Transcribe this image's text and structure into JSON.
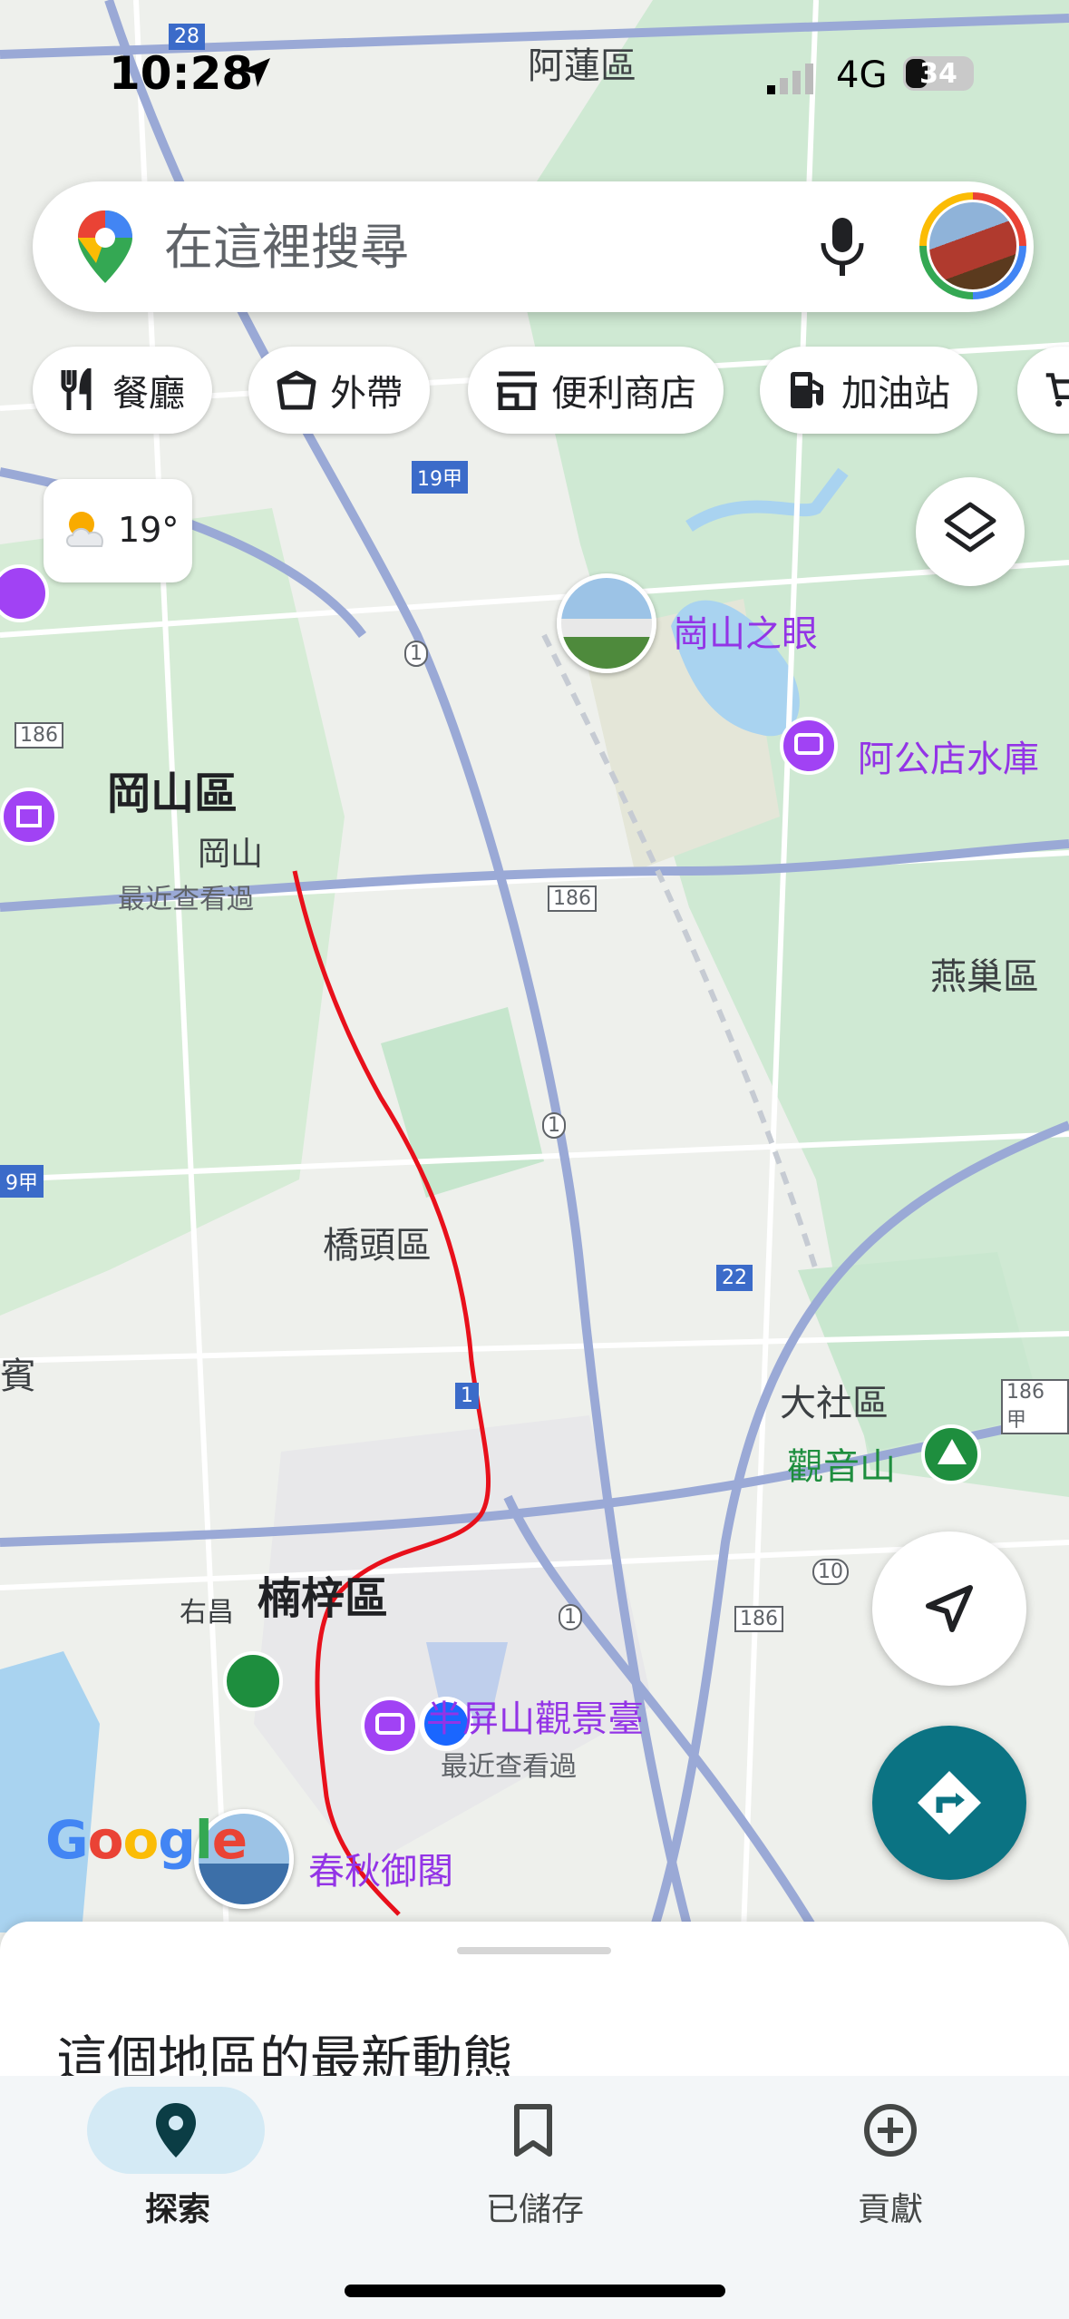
{
  "status_bar": {
    "time": "10:28",
    "network": "4G",
    "battery": "34"
  },
  "search": {
    "placeholder": "在這裡搜尋"
  },
  "chips": [
    {
      "label": "餐廳",
      "icon": "restaurant-icon"
    },
    {
      "label": "外帶",
      "icon": "takeout-icon"
    },
    {
      "label": "便利商店",
      "icon": "convenience-store-icon"
    },
    {
      "label": "加油站",
      "icon": "gas-station-icon"
    }
  ],
  "weather": {
    "temp": "19°"
  },
  "map": {
    "top_district": "阿蓮區",
    "poi_gangshan_eye": "崗山之眼",
    "poi_agongdian": "阿公店水庫",
    "district_gangshan": "岡山區",
    "station_gangshan": "岡山",
    "recently_viewed_1": "最近查看過",
    "district_yanchao": "燕巢區",
    "district_qiaotou": "橋頭區",
    "district_dashe": "大社區",
    "poi_guanyinshan": "觀音山",
    "district_nanzi": "楠梓區",
    "place_youchang": "右昌",
    "poi_pingshan": "半屏山觀景臺",
    "recently_viewed_2": "最近查看過",
    "poi_chunqiu": "春秋御閣",
    "edge_left": "賓",
    "shields": [
      "28",
      "1",
      "19甲",
      "186",
      "186",
      "1",
      "1",
      "22",
      "1",
      "10",
      "186",
      "186甲",
      "1",
      "9甲"
    ]
  },
  "colors": {
    "route": "#e8101b",
    "poi": "#9334e6",
    "directions": "#0b7383",
    "nav_active": "#d4eaf5"
  },
  "sheet": {
    "title": "這個地區的最新動態"
  },
  "bottom_nav": [
    {
      "label": "探索",
      "icon": "explore-pin-icon",
      "active": true
    },
    {
      "label": "已儲存",
      "icon": "bookmark-icon",
      "active": false
    },
    {
      "label": "貢獻",
      "icon": "add-circle-icon",
      "active": false
    }
  ],
  "logo_text": "Google"
}
